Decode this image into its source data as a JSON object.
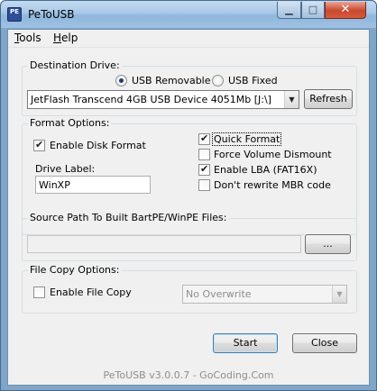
{
  "window": {
    "title": "PeToUSB",
    "app_icon_text": "PE"
  },
  "menu": {
    "tools": "Tools",
    "help": "Help"
  },
  "destination": {
    "group_title": "Destination Drive:",
    "usb_removable": "USB Removable",
    "usb_fixed": "USB Fixed",
    "selected": "usb_removable",
    "drive": "JetFlash Transcend 4GB USB Device 4051Mb [J:\\]",
    "refresh": "Refresh"
  },
  "format": {
    "group_title": "Format Options:",
    "enable_disk_format": {
      "label": "Enable Disk Format",
      "checked": true
    },
    "quick_format": {
      "label": "Quick Format",
      "checked": true
    },
    "force_volume_dismount": {
      "label": "Force Volume Dismount",
      "checked": false
    },
    "enable_lba": {
      "label": "Enable LBA (FAT16X)",
      "checked": true
    },
    "dont_rewrite_mbr": {
      "label": "Don't rewrite MBR code",
      "checked": false
    },
    "drive_label_title": "Drive Label:",
    "drive_label_value": "WinXP"
  },
  "source": {
    "group_title": "Source Path To Built BartPE/WinPE Files:",
    "path_value": "",
    "browse": "..."
  },
  "file_copy": {
    "group_title": "File Copy Options:",
    "enable_file_copy": {
      "label": "Enable File Copy",
      "checked": false
    },
    "mode": "No Overwrite"
  },
  "actions": {
    "start": "Start",
    "close": "Close"
  },
  "footer": "PeToUSB v3.0.0.7 - GoCoding.Com"
}
